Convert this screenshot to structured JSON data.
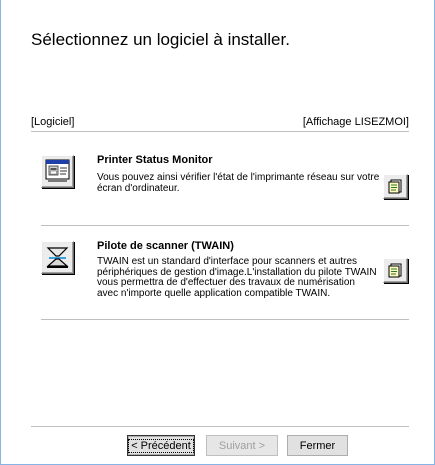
{
  "heading": "Sélectionnez un logiciel à installer.",
  "list_header": {
    "left": "[Logiciel]",
    "right": "[Affichage LISEZMOI]"
  },
  "items": [
    {
      "title": "Printer Status Monitor",
      "description": "Vous pouvez ainsi vérifier l'état de l'imprimante réseau sur votre\nécran d'ordinateur.",
      "icon": "printer-status-icon",
      "readme_icon": "readme-document-icon"
    },
    {
      "title": "Pilote de scanner (TWAIN)",
      "description": "TWAIN est un standard d'interface pour scanners et autres\npériphériques de gestion d'image.L'installation du pilote TWAIN\nvous permettra de d'effectuer des travaux de numérisation\navec n'importe quelle application compatible TWAIN.",
      "icon": "scanner-icon",
      "readme_icon": "readme-document-icon"
    }
  ],
  "buttons": {
    "back": "< Précédent",
    "next": "Suivant >",
    "close": "Fermer"
  }
}
